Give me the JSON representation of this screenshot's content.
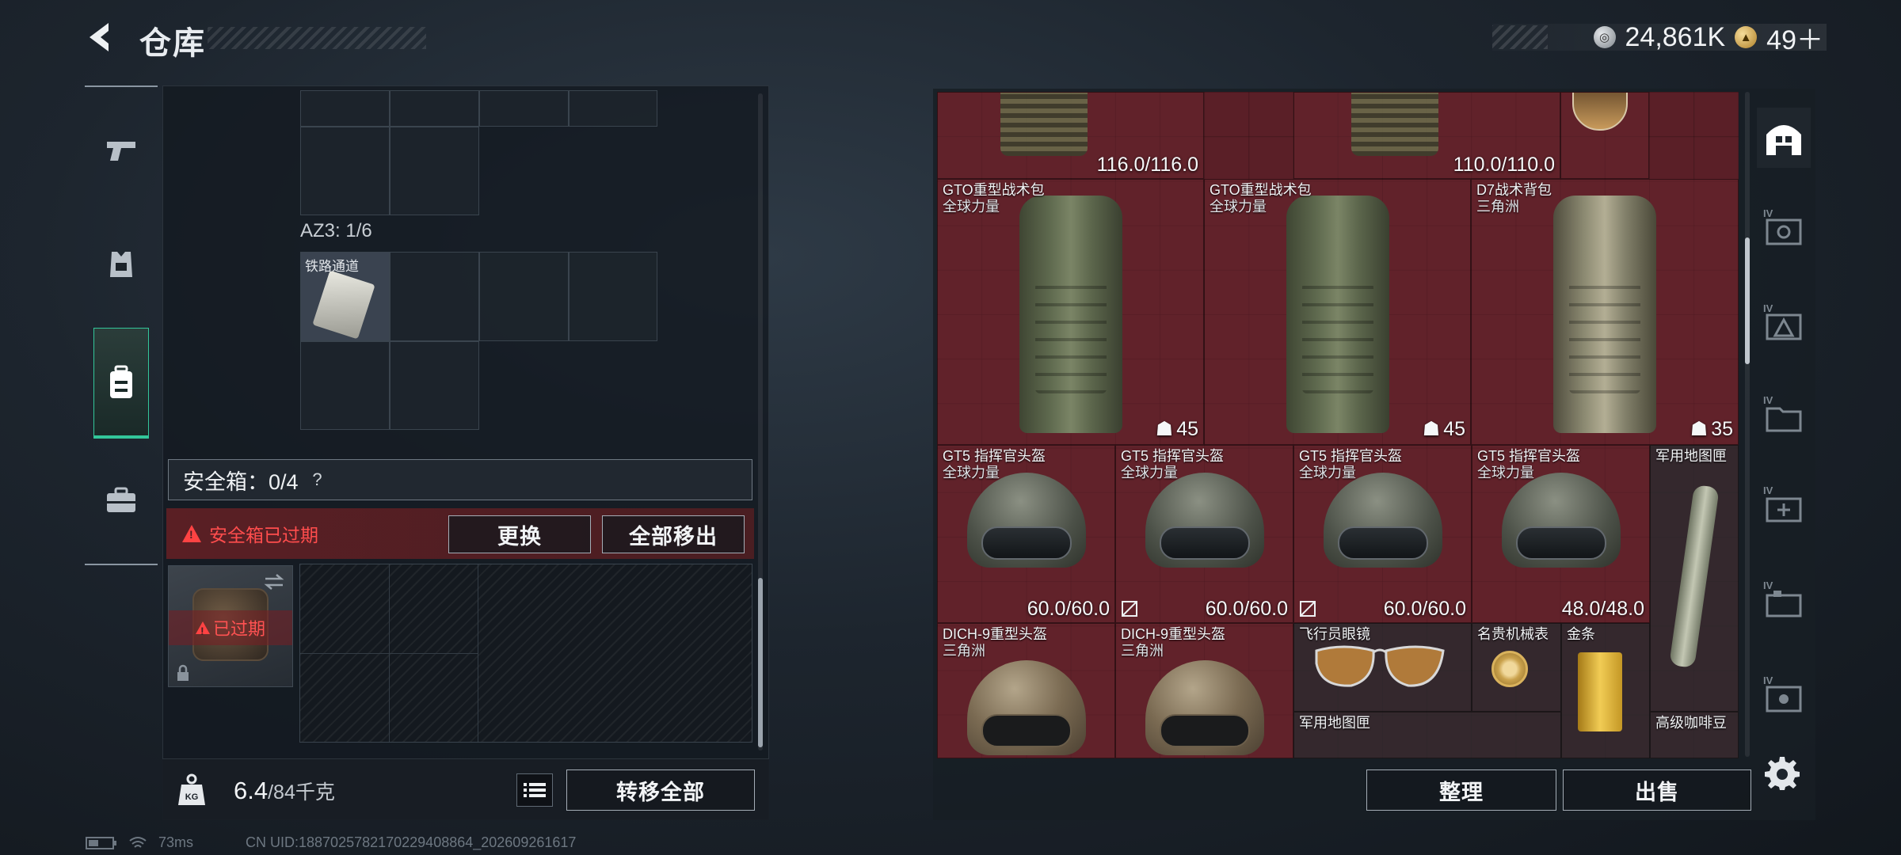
{
  "header": {
    "title": "仓库",
    "currency": [
      {
        "icon": "silver-coin-icon",
        "value": "24,861K"
      },
      {
        "icon": "gold-coin-icon",
        "value": "49＋"
      }
    ]
  },
  "left_nav": {
    "items": [
      {
        "name": "weapons",
        "icon": "pistol-icon",
        "active": false
      },
      {
        "name": "armor",
        "icon": "vest-icon",
        "active": false
      },
      {
        "name": "backpack",
        "icon": "backpack-icon",
        "active": true
      },
      {
        "name": "case",
        "icon": "briefcase-icon",
        "active": false
      }
    ]
  },
  "storage": {
    "section_label": "AZ3: 1/6",
    "item_caption": "铁路通道"
  },
  "safebox": {
    "label": "安全箱：0/4",
    "help": "?",
    "expired_message": "安全箱已过期",
    "replace_button": "更换",
    "move_all_out_button": "全部移出",
    "slot_status": "已过期"
  },
  "weight": {
    "current": "6.4",
    "max": "/84千克",
    "transfer_all_button": "转移全部"
  },
  "status_bar": {
    "ping": "73ms",
    "uid": "CN UID:1887025782170229408864_202609261617"
  },
  "stash": {
    "top_row": [
      {
        "durability": "116.0/116.0"
      },
      {
        "durability": "110.0/110.0"
      }
    ],
    "backpacks": [
      {
        "name": "GTO重型战术包",
        "sub": "全球力量",
        "capacity": "45"
      },
      {
        "name": "GTO重型战术包",
        "sub": "全球力量",
        "capacity": "45"
      },
      {
        "name": "D7战术背包",
        "sub": "三角洲",
        "capacity": "35"
      }
    ],
    "helmets": [
      {
        "name": "GT5 指挥官头盔",
        "sub": "全球力量",
        "durability": "60.0/60.0"
      },
      {
        "name": "GT5 指挥官头盔",
        "sub": "全球力量",
        "durability": "60.0/60.0"
      },
      {
        "name": "GT5 指挥官头盔",
        "sub": "全球力量",
        "durability": "60.0/60.0"
      },
      {
        "name": "GT5 指挥官头盔",
        "sub": "全球力量",
        "durability": "48.0/48.0"
      }
    ],
    "map_case_top": "军用地图匣",
    "dich_helmets": [
      {
        "name": "DICH-9重型头盔",
        "sub": "三角洲"
      },
      {
        "name": "DICH-9重型头盔",
        "sub": "三角洲"
      }
    ],
    "aviator_glasses": "飞行员眼镜",
    "watch": "名贵机械表",
    "gold_bar": "金条",
    "map_case_bottom": "军用地图匣",
    "coffee": "高级咖啡豆",
    "sort_button": "整理",
    "sell_button": "出售"
  },
  "right_tabs": [
    {
      "label": "IV",
      "active": false
    },
    {
      "label": "IV",
      "active": false
    },
    {
      "label": "IV",
      "active": false
    },
    {
      "label": "IV",
      "active": false
    },
    {
      "label": "IV",
      "active": false
    },
    {
      "label": "IV",
      "active": false
    }
  ],
  "colors": {
    "accent_green": "#33c79a",
    "stash_red": "#5a1f27",
    "warning_red": "#ff4d4d"
  }
}
